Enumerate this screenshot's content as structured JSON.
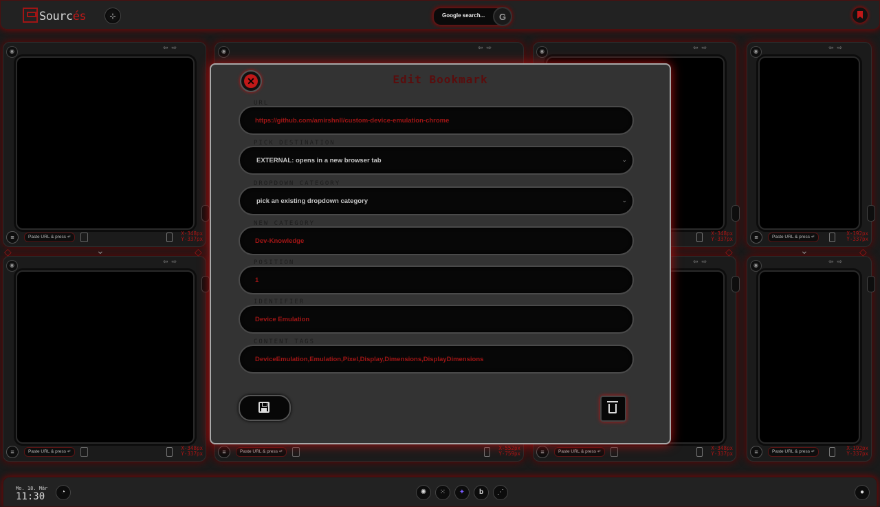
{
  "header": {
    "logo_prefix": "Sourc",
    "logo_accent": "és",
    "search_label": "Google search...",
    "google_letter": "G"
  },
  "panels": {
    "paste_label": "Paste URL & press ↵",
    "dims_348": [
      "X-348px",
      "Y-337px"
    ],
    "dims_192": [
      "X-192px",
      "Y-337px"
    ],
    "dims_552": [
      "X-552px",
      "Y-759px"
    ]
  },
  "modal": {
    "title": "Edit Bookmark",
    "close_glyph": "✕",
    "fields": [
      {
        "label": "URL",
        "value": "https://github.com/amirshnll/custom-device-emulation-chrome"
      },
      {
        "label": "PICK DESTINATION",
        "value": "EXTERNAL: opens in a new browser tab"
      },
      {
        "label": "DROPDOWN CATEGORY",
        "value": "pick an existing dropdown category"
      },
      {
        "label": "NEW CATEGORY",
        "value": "Dev-Knowledge"
      },
      {
        "label": "POSITION",
        "value": "1"
      },
      {
        "label": "IDENTIFIER",
        "value": "Device Emulation"
      },
      {
        "label": "CONTENT TAGS",
        "value": "DeviceEmulation,Emulation,Pixel,Display,Dimensions,DisplayDimensions"
      }
    ]
  },
  "footer": {
    "date": "Mo. 18. Mär",
    "time": "11:30"
  },
  "colors": {
    "accent": "#c01818",
    "glow": "#8a0000",
    "modal_bg": "#333333"
  }
}
